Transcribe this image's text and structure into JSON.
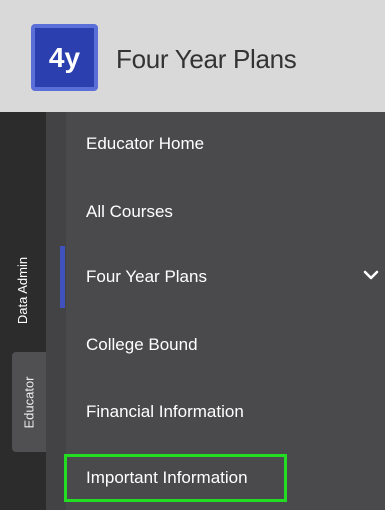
{
  "header": {
    "logo_text": "4y",
    "title": "Four Year Plans"
  },
  "rail": {
    "tabs": [
      {
        "label": "Data Admin",
        "active": false
      },
      {
        "label": "Educator",
        "active": true
      }
    ]
  },
  "menu": {
    "items": [
      {
        "label": "Educator Home"
      },
      {
        "label": "All Courses"
      },
      {
        "label": "Four Year Plans",
        "active": true,
        "expandable": true,
        "icon": "chevron-down-icon"
      },
      {
        "label": "College Bound"
      },
      {
        "label": "Financial Information"
      },
      {
        "label": "Important Information",
        "highlighted": true
      }
    ]
  },
  "colors": {
    "header_bg": "#d9d9d9",
    "logo_bg": "#2b3fae",
    "menu_bg": "#4a4a4c",
    "rail_bg": "#2c2c2d",
    "active_accent": "#3f52c0",
    "highlight_border": "#22dd22"
  }
}
